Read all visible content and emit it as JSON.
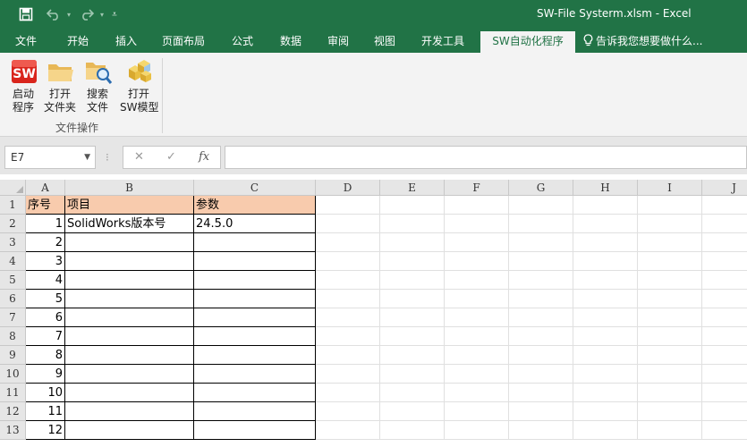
{
  "window": {
    "title": "SW-File Systerm.xlsm  -  Excel"
  },
  "quick_access": {
    "save_icon": "save-icon",
    "undo_icon": "undo-icon",
    "redo_icon": "redo-icon",
    "customize_icon": "customize-dropdown-icon"
  },
  "tabs": [
    {
      "label": "文件"
    },
    {
      "label": "开始"
    },
    {
      "label": "插入"
    },
    {
      "label": "页面布局"
    },
    {
      "label": "公式"
    },
    {
      "label": "数据"
    },
    {
      "label": "审阅"
    },
    {
      "label": "视图"
    },
    {
      "label": "开发工具"
    },
    {
      "label": "SW自动化程序",
      "active": true
    },
    {
      "label": "告诉我您想要做什么..."
    }
  ],
  "ribbon": {
    "buttons": [
      {
        "line1": "启动",
        "line2": "程序",
        "icon": "solidworks-logo-icon"
      },
      {
        "line1": "打开",
        "line2": "文件夹",
        "icon": "folder-open-icon"
      },
      {
        "line1": "搜索",
        "line2": "文件",
        "icon": "folder-search-icon"
      },
      {
        "line1": "打开",
        "line2": "SW模型",
        "icon": "3d-model-icon"
      }
    ],
    "group_label": "文件操作"
  },
  "formula_bar": {
    "name_box": "E7",
    "cancel_symbol": "✕",
    "confirm_symbol": "✓",
    "fx_symbol": "fx",
    "separator": "⁝",
    "value": ""
  },
  "sheet": {
    "columns": [
      "A",
      "B",
      "C",
      "D",
      "E",
      "F",
      "G",
      "H",
      "I",
      "J"
    ],
    "rows": [
      "1",
      "2",
      "3",
      "4",
      "5",
      "6",
      "7",
      "8",
      "9",
      "10",
      "11",
      "12",
      "13"
    ],
    "header_row": [
      "序号",
      "项目",
      "参数"
    ],
    "data_rows": [
      [
        "1",
        "SolidWorks版本号",
        "24.5.0"
      ],
      [
        "2",
        "",
        ""
      ],
      [
        "3",
        "",
        ""
      ],
      [
        "4",
        "",
        ""
      ],
      [
        "5",
        "",
        ""
      ],
      [
        "6",
        "",
        ""
      ],
      [
        "7",
        "",
        ""
      ],
      [
        "8",
        "",
        ""
      ],
      [
        "9",
        "",
        ""
      ],
      [
        "10",
        "",
        ""
      ],
      [
        "11",
        "",
        ""
      ],
      [
        "12",
        "",
        ""
      ]
    ],
    "header_fill": "#f8cbad"
  },
  "colors": {
    "brand": "#217346",
    "ribbon_bg": "#f3f3f3"
  }
}
